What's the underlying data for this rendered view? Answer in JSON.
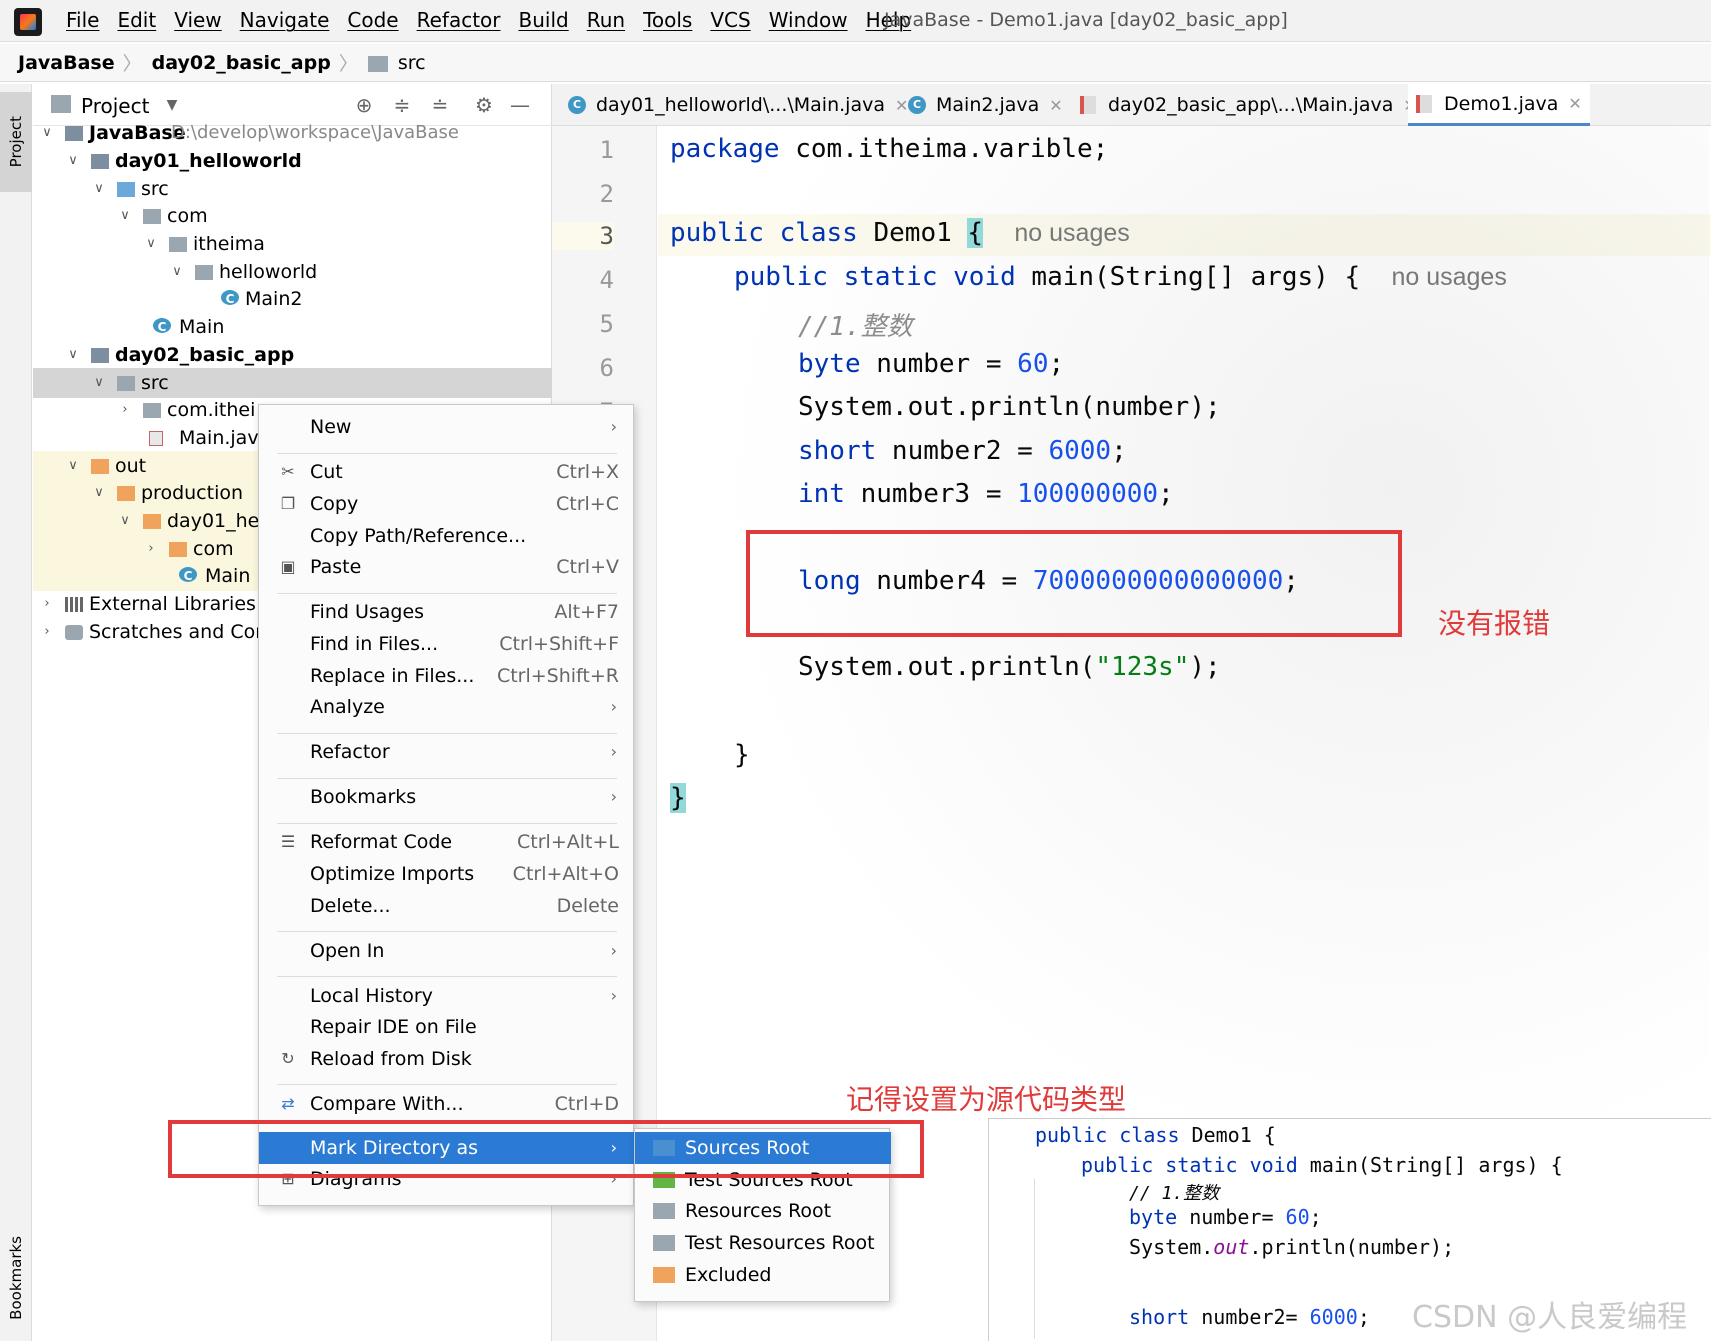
{
  "menubar": {
    "items": [
      "File",
      "Edit",
      "View",
      "Navigate",
      "Code",
      "Refactor",
      "Build",
      "Run",
      "Tools",
      "VCS",
      "Window",
      "Help"
    ],
    "window_title": "JavaBase - Demo1.java [day02_basic_app]"
  },
  "breadcrumb": [
    "JavaBase",
    "day02_basic_app",
    "src"
  ],
  "sidebar": {
    "project_tab": "Project",
    "bookmarks_tab": "Bookmarks"
  },
  "project_panel": {
    "title": "Project",
    "tree": [
      {
        "label": "JavaBase",
        "path": "D:\\develop\\workspace\\JavaBase"
      },
      {
        "label": "day01_helloworld"
      },
      {
        "label": "src"
      },
      {
        "label": "com"
      },
      {
        "label": "itheima"
      },
      {
        "label": "helloworld"
      },
      {
        "label": "Main2"
      },
      {
        "label": "Main"
      },
      {
        "label": "day02_basic_app"
      },
      {
        "label": "src"
      },
      {
        "label": "com.ithei"
      },
      {
        "label": "Main.java"
      },
      {
        "label": "out"
      },
      {
        "label": "production"
      },
      {
        "label": "day01_he"
      },
      {
        "label": "com"
      },
      {
        "label": "Main"
      },
      {
        "label": "External Libraries"
      },
      {
        "label": "Scratches and Cons"
      }
    ]
  },
  "tabs": [
    {
      "label": "day01_helloworld\\...\\Main.java"
    },
    {
      "label": "Main2.java"
    },
    {
      "label": "day02_basic_app\\...\\Main.java"
    },
    {
      "label": "Demo1.java"
    }
  ],
  "editor": {
    "line_numbers": [
      "1",
      "2",
      "3",
      "4",
      "5",
      "6",
      "7"
    ],
    "lines": {
      "l1_kw": "package",
      "l1_rest": " com.itheima.varible;",
      "l3_kw": "public class",
      "l3_name": " Demo1 ",
      "l3_brace": "{",
      "l3_hint": "no usages",
      "l4_kw": "public static void",
      "l4_rest": " main(String[] args) {",
      "l4_hint": "no usages",
      "l5_cmt": "//1.整数",
      "l6_kw": "byte",
      "l6_rest": " number = ",
      "l6_num": "60",
      "l6_end": ";",
      "l7": "System.out.println(number);",
      "l8_kw": "short",
      "l8_rest": " number2 = ",
      "l8_num": "6000",
      "l8_end": ";",
      "l9_kw": "int",
      "l9_rest": " number3 = ",
      "l9_num": "100000000",
      "l9_end": ";",
      "l10_kw": "long",
      "l10_rest": " number4 = ",
      "l10_num": "7000000000000000",
      "l10_end": ";",
      "l11_a": "System.out.println(",
      "l11_str": "\"123s\"",
      "l11_b": ");",
      "l12": "}",
      "l13": "}"
    }
  },
  "annotations": {
    "no_error": "没有报错",
    "mark_hint": "记得设置为源代码类型"
  },
  "context_menu": {
    "items": [
      {
        "label": "New",
        "arrow": "›"
      },
      {
        "label": "Cut",
        "shortcut": "Ctrl+X"
      },
      {
        "label": "Copy",
        "shortcut": "Ctrl+C"
      },
      {
        "label": "Copy Path/Reference..."
      },
      {
        "label": "Paste",
        "shortcut": "Ctrl+V"
      },
      {
        "label": "Find Usages",
        "shortcut": "Alt+F7"
      },
      {
        "label": "Find in Files...",
        "shortcut": "Ctrl+Shift+F"
      },
      {
        "label": "Replace in Files...",
        "shortcut": "Ctrl+Shift+R"
      },
      {
        "label": "Analyze",
        "arrow": "›"
      },
      {
        "label": "Refactor",
        "arrow": "›"
      },
      {
        "label": "Bookmarks",
        "arrow": "›"
      },
      {
        "label": "Reformat Code",
        "shortcut": "Ctrl+Alt+L"
      },
      {
        "label": "Optimize Imports",
        "shortcut": "Ctrl+Alt+O"
      },
      {
        "label": "Delete...",
        "shortcut": "Delete"
      },
      {
        "label": "Open In",
        "arrow": "›"
      },
      {
        "label": "Local History",
        "arrow": "›"
      },
      {
        "label": "Repair IDE on File"
      },
      {
        "label": "Reload from Disk"
      },
      {
        "label": "Compare With...",
        "shortcut": "Ctrl+D"
      },
      {
        "label": "Mark Directory as",
        "arrow": "›"
      },
      {
        "label": "Diagrams",
        "arrow": "›"
      }
    ]
  },
  "submenu": {
    "items": [
      {
        "label": "Sources Root",
        "color": "#4a8fd0"
      },
      {
        "label": "Test Sources Root",
        "color": "#62b543"
      },
      {
        "label": "Resources Root",
        "color": "#9aa7b0"
      },
      {
        "label": "Test Resources Root",
        "color": "#9aa7b0"
      },
      {
        "label": "Excluded",
        "color": "#f0a35c"
      }
    ]
  },
  "inset_code": {
    "a_kw": "public class",
    "a_rest": " Demo1 {",
    "b_kw": "public static void",
    "b_rest": " main(String[] args) {",
    "c": "// 1.整数",
    "d_kw": "byte",
    "d_rest": " number= ",
    "d_num": "60",
    "d_end": ";",
    "e_a": "System.",
    "e_out": "out",
    "e_b": ".println(number);",
    "f_kw": "short",
    "f_rest": " number2= ",
    "f_num": "6000",
    "f_end": ";"
  },
  "watermark": "CSDN @人良爱编程"
}
